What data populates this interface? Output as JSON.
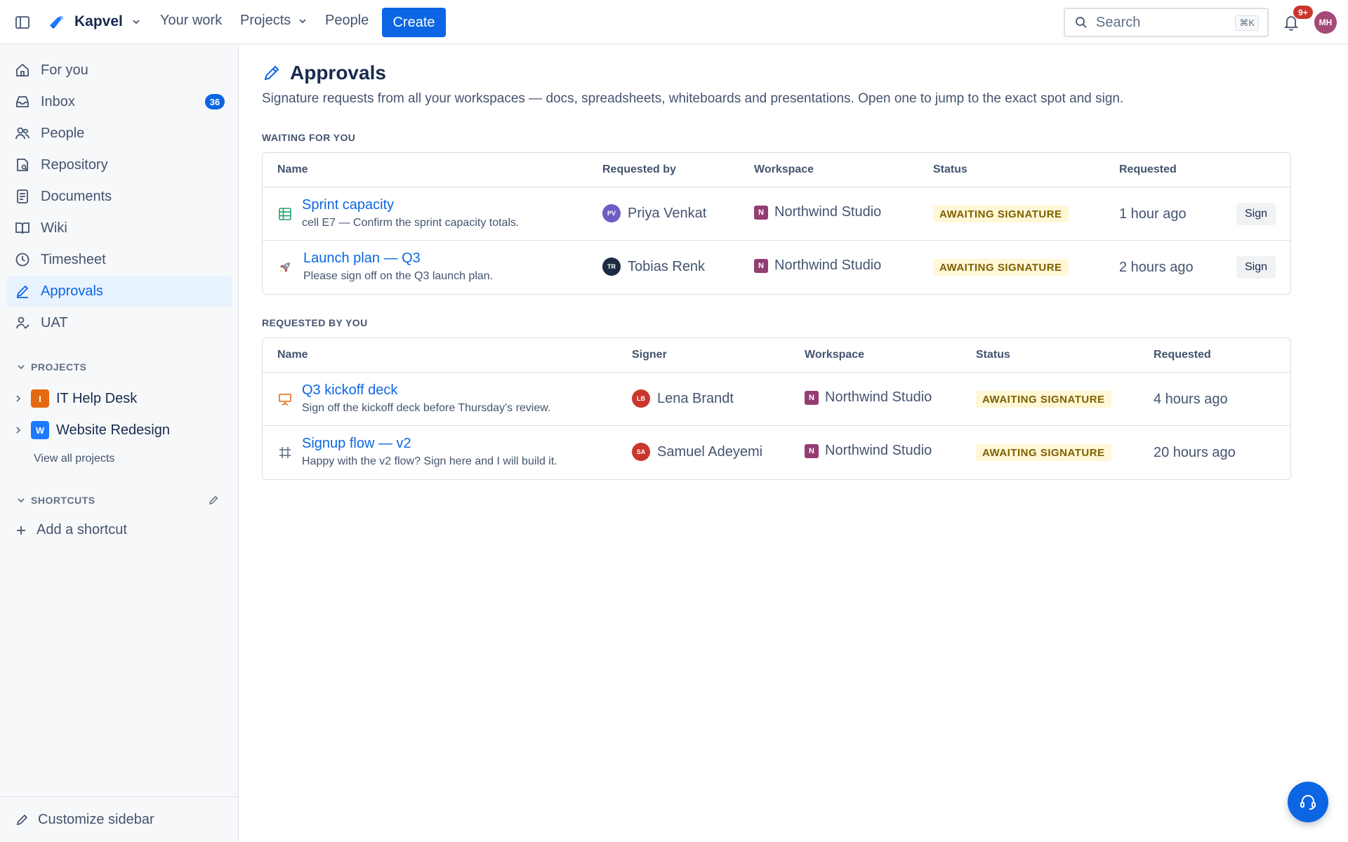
{
  "app": {
    "name": "Kapvel",
    "nav": {
      "your_work": "Your work",
      "projects": "Projects",
      "people": "People"
    },
    "create_label": "Create",
    "search_placeholder": "Search",
    "search_shortcut": "⌘K",
    "notifications_badge": "9+",
    "user_initials": "MH"
  },
  "sidebar": {
    "items": [
      {
        "label": "For you",
        "icon": "home-icon"
      },
      {
        "label": "Inbox",
        "icon": "inbox-icon",
        "badge": "36"
      },
      {
        "label": "People",
        "icon": "people-icon"
      },
      {
        "label": "Repository",
        "icon": "repository-icon"
      },
      {
        "label": "Documents",
        "icon": "document-icon"
      },
      {
        "label": "Wiki",
        "icon": "book-icon"
      },
      {
        "label": "Timesheet",
        "icon": "clock-icon"
      },
      {
        "label": "Approvals",
        "icon": "pen-icon",
        "active": true
      },
      {
        "label": "UAT",
        "icon": "user-check-icon"
      }
    ],
    "projects_heading": "PROJECTS",
    "projects": [
      {
        "initial": "I",
        "name": "IT Help Desk",
        "color": "#e56910"
      },
      {
        "initial": "W",
        "name": "Website Redesign",
        "color": "#1d7afc"
      }
    ],
    "view_all_projects": "View all projects",
    "shortcuts_heading": "SHORTCUTS",
    "add_shortcut": "Add a shortcut",
    "customize": "Customize sidebar"
  },
  "page": {
    "title": "Approvals",
    "description": "Signature requests from all your workspaces — docs, spreadsheets, whiteboards and presentations. Open one to jump to the exact spot and sign.",
    "waiting": {
      "heading": "WAITING FOR YOU",
      "columns": {
        "name": "Name",
        "person": "Requested by",
        "workspace": "Workspace",
        "status": "Status",
        "requested": "Requested"
      },
      "rows": [
        {
          "icon": "spreadsheet-icon",
          "title": "Sprint capacity",
          "subtitle": "cell E7 — Confirm the sprint capacity totals.",
          "person_initials": "PV",
          "person": "Priya Venkat",
          "avatar_color": "#6e5dc6",
          "ws_initial": "N",
          "workspace": "Northwind Studio",
          "status": "AWAITING SIGNATURE",
          "requested": "1 hour ago",
          "action": "Sign"
        },
        {
          "icon": "rocket-icon",
          "title": "Launch plan — Q3",
          "subtitle": "Please sign off on the Q3 launch plan.",
          "person_initials": "TR",
          "person": "Tobias Renk",
          "avatar_color": "#1c2b41",
          "ws_initial": "N",
          "workspace": "Northwind Studio",
          "status": "AWAITING SIGNATURE",
          "requested": "2 hours ago",
          "action": "Sign"
        }
      ]
    },
    "requested": {
      "heading": "REQUESTED BY YOU",
      "columns": {
        "name": "Name",
        "person": "Signer",
        "workspace": "Workspace",
        "status": "Status",
        "requested": "Requested"
      },
      "rows": [
        {
          "icon": "presentation-icon",
          "title": "Q3 kickoff deck",
          "subtitle": "Sign off the kickoff deck before Thursday's review.",
          "person_initials": "LB",
          "person": "Lena Brandt",
          "avatar_color": "#c9372c",
          "ws_initial": "N",
          "workspace": "Northwind Studio",
          "status": "AWAITING SIGNATURE",
          "requested": "4 hours ago"
        },
        {
          "icon": "whiteboard-frame-icon",
          "title": "Signup flow — v2",
          "subtitle": "Happy with the v2 flow? Sign here and I will build it.",
          "person_initials": "SA",
          "person": "Samuel Adeyemi",
          "avatar_color": "#c9372c",
          "ws_initial": "N",
          "workspace": "Northwind Studio",
          "status": "AWAITING SIGNATURE",
          "requested": "20 hours ago"
        }
      ]
    }
  },
  "colors": {
    "accent": "#0c66e4",
    "status_bg": "#fff7d6",
    "status_text": "#7f5f01"
  }
}
